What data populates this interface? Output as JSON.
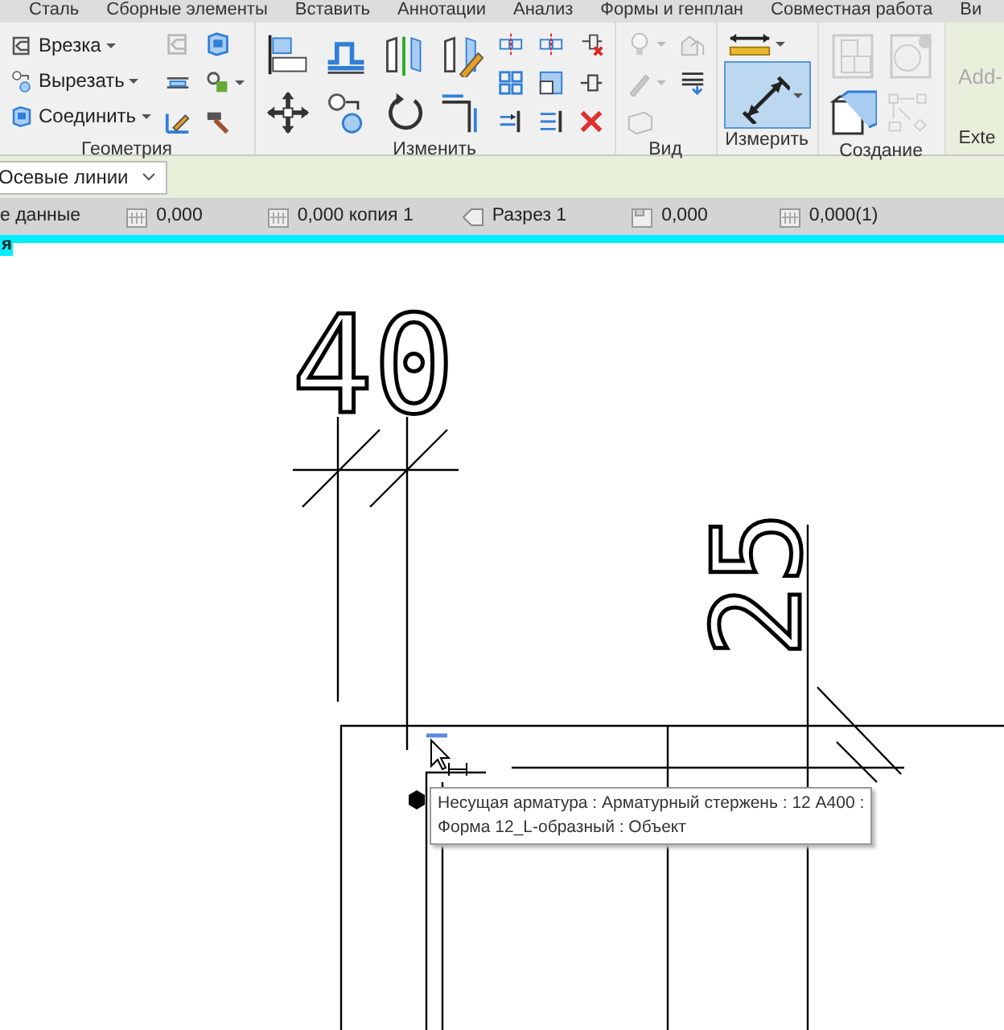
{
  "ribbon_tabs": [
    {
      "label": "Сталь",
      "selected": false
    },
    {
      "label": "Сборные элементы",
      "selected": false
    },
    {
      "label": "Вставить",
      "selected": false
    },
    {
      "label": "Аннотации",
      "selected": false
    },
    {
      "label": "Анализ",
      "selected": false
    },
    {
      "label": "Формы и генплан",
      "selected": false
    },
    {
      "label": "Совместная работа",
      "selected": false
    },
    {
      "label": "Ви",
      "selected": false
    }
  ],
  "panels": [
    {
      "title": "Геометрия",
      "buttons": [
        {
          "label": "Врезка",
          "dropdown": true
        },
        {
          "label": "Вырезать",
          "dropdown": true
        },
        {
          "label": "Соединить",
          "dropdown": true
        }
      ],
      "tools": [
        {
          "disabled": true,
          "dropdown": false
        },
        {
          "disabled": false,
          "dropdown": false
        },
        {
          "disabled": false,
          "dropdown": false
        },
        {
          "disabled": false,
          "dropdown": true
        },
        {
          "disabled": false,
          "dropdown": false
        },
        {
          "disabled": false,
          "dropdown": false
        }
      ]
    },
    {
      "title": "Изменить",
      "large_tools": [
        {
          "disabled": false
        },
        {
          "disabled": false
        },
        {
          "disabled": false
        },
        {
          "disabled": false
        },
        {
          "disabled": false
        },
        {
          "disabled": false
        },
        {
          "disabled": false
        },
        {
          "disabled": false
        }
      ],
      "tools": [
        {
          "disabled": false,
          "dropdown": false
        },
        {
          "disabled": false,
          "dropdown": false
        },
        {
          "disabled": false,
          "dropdown": false
        },
        {
          "disabled": false,
          "dropdown": false
        },
        {
          "disabled": false,
          "dropdown": false
        },
        {
          "disabled": false,
          "dropdown": false
        },
        {
          "disabled": false,
          "dropdown": false
        },
        {
          "disabled": false,
          "dropdown": false
        },
        {
          "disabled": false,
          "dropdown": false
        }
      ]
    },
    {
      "title": "Вид",
      "tools": [
        {
          "disabled": true,
          "dropdown": true
        },
        {
          "disabled": true,
          "dropdown": false
        },
        {
          "disabled": true,
          "dropdown": true
        },
        {
          "disabled": false,
          "dropdown": false
        },
        {
          "disabled": true,
          "dropdown": false
        }
      ]
    },
    {
      "title": "Измерить",
      "tools": [
        {
          "disabled": false,
          "dropdown": true,
          "selected": false
        },
        {
          "disabled": false,
          "dropdown": true,
          "selected": true
        }
      ]
    },
    {
      "title": "Создание",
      "tools": [
        {
          "disabled": true,
          "dropdown": false
        },
        {
          "disabled": true,
          "dropdown": false
        },
        {
          "disabled": false,
          "dropdown": false
        },
        {
          "disabled": true,
          "dropdown": false
        }
      ]
    },
    {
      "title": "Exte",
      "add_in": {
        "label": "Add-",
        "disabled": true
      }
    }
  ],
  "options_bar": {
    "dropdown": "Осевые линии"
  },
  "status_bar": [
    {
      "kind": "text",
      "text": "е данные"
    },
    {
      "kind": "grid",
      "text": "0,000"
    },
    {
      "kind": "grid",
      "text": "0,000 копия 1"
    },
    {
      "kind": "section",
      "text": "Разрез 1"
    },
    {
      "kind": "sheet",
      "text": "0,000"
    },
    {
      "kind": "grid",
      "text": "0,000(1)"
    }
  ],
  "view_tab": "я",
  "drawing": {
    "tags": [
      "40",
      "25"
    ],
    "tooltip": [
      "Несущая арматура : Арматурный стержень : 12 А400 :",
      "Форма 12_L-образный : Объект"
    ]
  }
}
